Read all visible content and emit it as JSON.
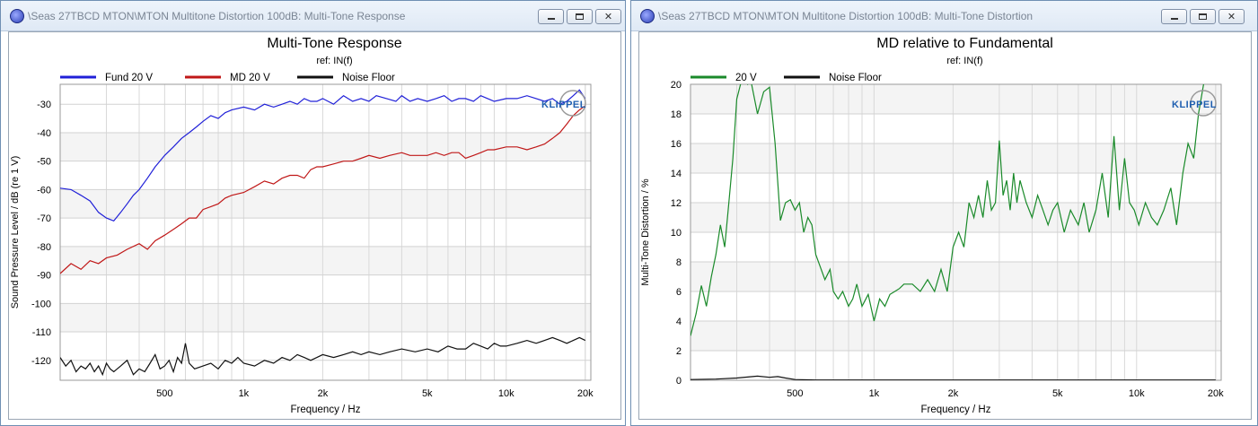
{
  "windows": {
    "left": {
      "title": "\\Seas 27TBCD MTON\\MTON Multitone Distortion 100dB: Multi-Tone Response"
    },
    "right": {
      "title": "\\Seas 27TBCD MTON\\MTON Multitone Distortion 100dB: Multi-Tone Distortion"
    }
  },
  "brand": {
    "logo_text": "KLIPPEL",
    "logo_color": "#1f5fb0"
  },
  "chart_data": [
    {
      "type": "line",
      "title": "Multi-Tone Response",
      "subtitle": "ref: IN(f)",
      "xlabel": "Frequency / Hz",
      "ylabel": "Sound Pressure Level / dB (re 1 V)",
      "xscale": "log",
      "xlim": [
        200,
        21000
      ],
      "ylim": [
        -127,
        -23
      ],
      "x_ticks": [
        500,
        1000,
        2000,
        5000,
        10000,
        20000
      ],
      "x_tick_labels": [
        "500",
        "1k",
        "2k",
        "5k",
        "10k",
        "20k"
      ],
      "y_ticks": [
        -120,
        -110,
        -100,
        -90,
        -80,
        -70,
        -60,
        -50,
        -40,
        -30
      ],
      "y_tick_labels": [
        "-120",
        "-110",
        "-100",
        "-90",
        "-80",
        "-70",
        "-60",
        "-50",
        "-40",
        "-30"
      ],
      "grid": true,
      "legend_position": "top-left",
      "series": [
        {
          "name": "Fund 20 V",
          "color": "#2020d8",
          "x": [
            200,
            220,
            240,
            260,
            280,
            300,
            320,
            340,
            360,
            380,
            400,
            430,
            460,
            500,
            540,
            580,
            620,
            660,
            700,
            750,
            800,
            850,
            900,
            1000,
            1100,
            1200,
            1300,
            1400,
            1500,
            1600,
            1700,
            1800,
            1900,
            2000,
            2200,
            2400,
            2600,
            2800,
            3000,
            3200,
            3500,
            3800,
            4000,
            4300,
            4600,
            5000,
            5400,
            5800,
            6200,
            6600,
            7000,
            7500,
            8000,
            8500,
            9000,
            10000,
            11000,
            12000,
            13000,
            14000,
            15000,
            16000,
            17000,
            18000,
            19000,
            20000
          ],
          "y": [
            -59.5,
            -60,
            -62,
            -64,
            -68,
            -70,
            -71,
            -68,
            -65,
            -62,
            -60,
            -56,
            -52,
            -48,
            -45,
            -42,
            -40,
            -38,
            -36,
            -34,
            -35,
            -33,
            -32,
            -31,
            -32,
            -30,
            -31,
            -30,
            -29,
            -30,
            -28,
            -29,
            -29,
            -28,
            -30,
            -27,
            -29,
            -28,
            -29,
            -27,
            -28,
            -29,
            -27,
            -29,
            -28,
            -29,
            -28,
            -27,
            -29,
            -28,
            -28,
            -29,
            -27,
            -28,
            -29,
            -28,
            -28,
            -27,
            -28,
            -29,
            -28,
            -30,
            -29,
            -27,
            -25,
            -28
          ]
        },
        {
          "name": "MD 20 V",
          "color": "#c01818",
          "x": [
            200,
            220,
            240,
            260,
            280,
            300,
            330,
            360,
            400,
            430,
            460,
            500,
            540,
            580,
            620,
            660,
            700,
            750,
            800,
            850,
            900,
            1000,
            1100,
            1200,
            1300,
            1400,
            1500,
            1600,
            1700,
            1800,
            1900,
            2000,
            2200,
            2400,
            2600,
            2800,
            3000,
            3300,
            3600,
            4000,
            4300,
            4600,
            5000,
            5400,
            5800,
            6200,
            6600,
            7000,
            7500,
            8000,
            8500,
            9000,
            10000,
            11000,
            12000,
            13000,
            14000,
            15000,
            16000,
            17000,
            18000,
            19000,
            20000
          ],
          "y": [
            -89.5,
            -86,
            -88,
            -85,
            -86,
            -84,
            -83,
            -81,
            -79,
            -81,
            -78,
            -76,
            -74,
            -72,
            -70,
            -70,
            -67,
            -66,
            -65,
            -63,
            -62,
            -61,
            -59,
            -57,
            -58,
            -56,
            -55,
            -55,
            -56,
            -53,
            -52,
            -52,
            -51,
            -50,
            -50,
            -49,
            -48,
            -49,
            -48,
            -47,
            -48,
            -48,
            -48,
            -47,
            -48,
            -47,
            -47,
            -49,
            -48,
            -47,
            -46,
            -46,
            -45,
            -45,
            -46,
            -45,
            -44,
            -42,
            -40,
            -37,
            -34,
            -32,
            -30.5
          ]
        },
        {
          "name": "Noise Floor",
          "color": "#111111",
          "x": [
            200,
            210,
            220,
            230,
            240,
            250,
            260,
            270,
            280,
            290,
            300,
            310,
            320,
            340,
            360,
            380,
            400,
            420,
            440,
            460,
            480,
            500,
            520,
            540,
            560,
            580,
            600,
            620,
            650,
            700,
            750,
            800,
            850,
            900,
            950,
            1000,
            1100,
            1200,
            1300,
            1400,
            1500,
            1600,
            1700,
            1800,
            1900,
            2000,
            2200,
            2400,
            2600,
            2800,
            3000,
            3300,
            3600,
            4000,
            4500,
            5000,
            5500,
            6000,
            6500,
            7000,
            7500,
            8000,
            8500,
            9000,
            9500,
            10000,
            11000,
            12000,
            13000,
            14000,
            15000,
            16000,
            17000,
            18000,
            19000,
            20000
          ],
          "y": [
            -119,
            -122,
            -120,
            -124,
            -122,
            -123,
            -121,
            -124,
            -122,
            -125,
            -121,
            -123,
            -124,
            -122,
            -120,
            -125,
            -123,
            -124,
            -121,
            -118,
            -123,
            -122,
            -120,
            -124,
            -119,
            -121,
            -114,
            -121,
            -123,
            -122,
            -121,
            -123,
            -120,
            -121,
            -119,
            -121,
            -122,
            -120,
            -121,
            -119,
            -120,
            -118,
            -119,
            -120,
            -119,
            -118,
            -119,
            -118,
            -117,
            -118,
            -117,
            -118,
            -117,
            -116,
            -117,
            -116,
            -117,
            -115,
            -116,
            -116,
            -114,
            -115,
            -116,
            -114,
            -115,
            -115,
            -114,
            -113,
            -114,
            -113,
            -112,
            -113,
            -114,
            -113,
            -112,
            -113
          ]
        }
      ]
    },
    {
      "type": "line",
      "title": "MD relative to Fundamental",
      "subtitle": "ref: IN(f)",
      "xlabel": "Frequency / Hz",
      "ylabel": "Multi-Tone Distortion / %",
      "xscale": "log",
      "xlim": [
        200,
        21000
      ],
      "ylim": [
        0,
        20
      ],
      "x_ticks": [
        500,
        1000,
        2000,
        5000,
        10000,
        20000
      ],
      "x_tick_labels": [
        "500",
        "1k",
        "2k",
        "5k",
        "10k",
        "20k"
      ],
      "y_ticks": [
        0,
        2,
        4,
        6,
        8,
        10,
        12,
        14,
        16,
        18,
        20
      ],
      "y_tick_labels": [
        "0",
        "2",
        "4",
        "6",
        "8",
        "10",
        "12",
        "14",
        "16",
        "18",
        "20"
      ],
      "grid": true,
      "legend_position": "top-left",
      "series": [
        {
          "name": "20 V",
          "color": "#1a8a2a",
          "x": [
            200,
            210,
            220,
            230,
            240,
            250,
            260,
            270,
            280,
            290,
            300,
            310,
            320,
            330,
            340,
            360,
            380,
            400,
            420,
            440,
            460,
            480,
            500,
            520,
            540,
            560,
            580,
            600,
            620,
            650,
            680,
            700,
            730,
            760,
            800,
            830,
            860,
            900,
            950,
            1000,
            1050,
            1100,
            1150,
            1200,
            1250,
            1300,
            1400,
            1500,
            1600,
            1700,
            1800,
            1900,
            2000,
            2100,
            2200,
            2300,
            2400,
            2500,
            2600,
            2700,
            2800,
            2900,
            3000,
            3100,
            3200,
            3300,
            3400,
            3500,
            3600,
            3800,
            4000,
            4200,
            4400,
            4600,
            4800,
            5000,
            5300,
            5600,
            6000,
            6300,
            6600,
            7000,
            7400,
            7800,
            8200,
            8600,
            9000,
            9400,
            9800,
            10200,
            10800,
            11400,
            12000,
            12700,
            13500,
            14200,
            15000,
            15700,
            16500,
            17200,
            18000,
            19000,
            20000
          ],
          "y": [
            3.0,
            4.5,
            6.4,
            5.0,
            7.0,
            8.5,
            10.5,
            9.0,
            12.0,
            15.0,
            19.0,
            20.0,
            20.5,
            20.0,
            20.2,
            18.0,
            19.5,
            19.8,
            16.0,
            10.8,
            12.0,
            12.2,
            11.5,
            12.0,
            10.0,
            11.0,
            10.5,
            8.5,
            7.8,
            6.8,
            7.5,
            6.0,
            5.5,
            6.0,
            5.0,
            5.5,
            6.5,
            5.0,
            5.8,
            4.0,
            5.5,
            5.0,
            5.8,
            6.0,
            6.2,
            6.5,
            6.5,
            6.0,
            6.8,
            6.0,
            7.5,
            6.0,
            9.0,
            10.0,
            9.0,
            12.0,
            11.0,
            12.5,
            11.0,
            13.5,
            11.5,
            12.0,
            16.2,
            12.5,
            13.5,
            11.5,
            14.0,
            12.0,
            13.5,
            12.0,
            11.0,
            12.5,
            11.5,
            10.5,
            11.5,
            12.0,
            10.0,
            11.5,
            10.5,
            12.0,
            10.0,
            11.5,
            14.0,
            11.0,
            16.5,
            11.5,
            15.0,
            12.0,
            11.5,
            10.5,
            12.0,
            11.0,
            10.5,
            11.5,
            13.0,
            10.5,
            14.0,
            16.0,
            15.0,
            18.0,
            20.0,
            20.5,
            20.5
          ]
        },
        {
          "name": "Noise Floor",
          "color": "#111111",
          "x": [
            200,
            250,
            300,
            330,
            360,
            400,
            430,
            460,
            500,
            550,
            600,
            700,
            800,
            1000,
            2000,
            5000,
            10000,
            20000
          ],
          "y": [
            0.05,
            0.08,
            0.15,
            0.22,
            0.28,
            0.2,
            0.25,
            0.15,
            0.05,
            0.03,
            0.02,
            0.02,
            0.02,
            0.02,
            0.02,
            0.02,
            0.02,
            0.02
          ]
        }
      ]
    }
  ]
}
